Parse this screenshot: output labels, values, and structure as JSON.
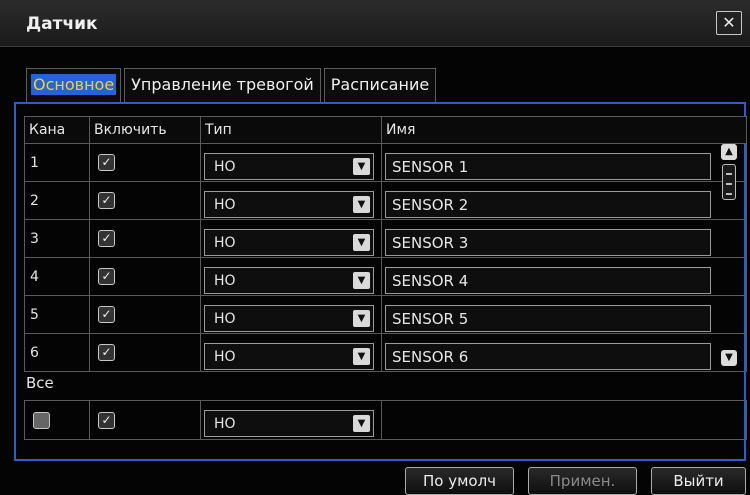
{
  "window": {
    "title": "Датчик",
    "close_label": "✕"
  },
  "tabs": [
    {
      "label": "Основное",
      "active": true
    },
    {
      "label": "Управление тревогой",
      "active": false
    },
    {
      "label": "Расписание",
      "active": false
    }
  ],
  "table": {
    "headers": [
      "Кана",
      "Включить",
      "Тип",
      "Имя"
    ],
    "rows": [
      {
        "channel": "1",
        "enabled": true,
        "type": "HO",
        "name": "SENSOR 1"
      },
      {
        "channel": "2",
        "enabled": true,
        "type": "HO",
        "name": "SENSOR 2"
      },
      {
        "channel": "3",
        "enabled": true,
        "type": "HO",
        "name": "SENSOR 3"
      },
      {
        "channel": "4",
        "enabled": true,
        "type": "HO",
        "name": "SENSOR 4"
      },
      {
        "channel": "5",
        "enabled": true,
        "type": "HO",
        "name": "SENSOR 5"
      },
      {
        "channel": "6",
        "enabled": true,
        "type": "HO",
        "name": "SENSOR 6"
      }
    ]
  },
  "all": {
    "label": "Все",
    "select_all": false,
    "enabled": true,
    "type": "HO"
  },
  "buttons": {
    "default": "По умолч",
    "apply": "Примен.",
    "exit": "Выйти"
  },
  "icons": {
    "check": "✓",
    "dropdown": "▼",
    "scroll_up": "▲",
    "scroll_down": "▼"
  },
  "colors": {
    "accent": "#2763d8",
    "active_tab_text": "#f6ce2a",
    "panel_border": "#2d5ec8"
  }
}
